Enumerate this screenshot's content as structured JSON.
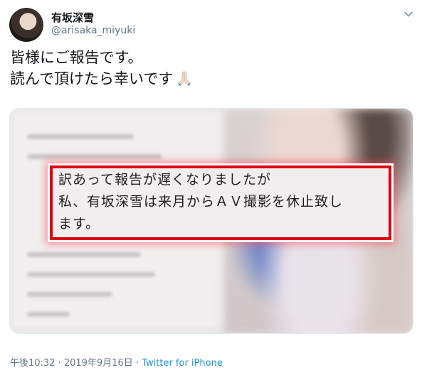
{
  "author": {
    "display_name": "有坂深雪",
    "handle": "@arisaka_miyuki",
    "avatar_icon": "avatar-photo"
  },
  "menu_icon": "chevron-down-icon",
  "tweet": {
    "lines": [
      "皆様にご報告です。",
      "読んで頂けたら幸いです"
    ],
    "emoji_icon": "folded-hands-icon"
  },
  "media": {
    "highlight_lines": [
      "訳あって報告が遅くなりましたが",
      "私、有坂深雪は来月からＡＶ撮影を休止致し",
      "ます。"
    ],
    "highlight_color": "#e00012"
  },
  "footer": {
    "time": "午後10:32",
    "separator": "·",
    "date": "2019年9月16日",
    "source": "Twitter for iPhone"
  },
  "colors": {
    "text": "#14171a",
    "secondary": "#657786",
    "link": "#1b95e0"
  }
}
